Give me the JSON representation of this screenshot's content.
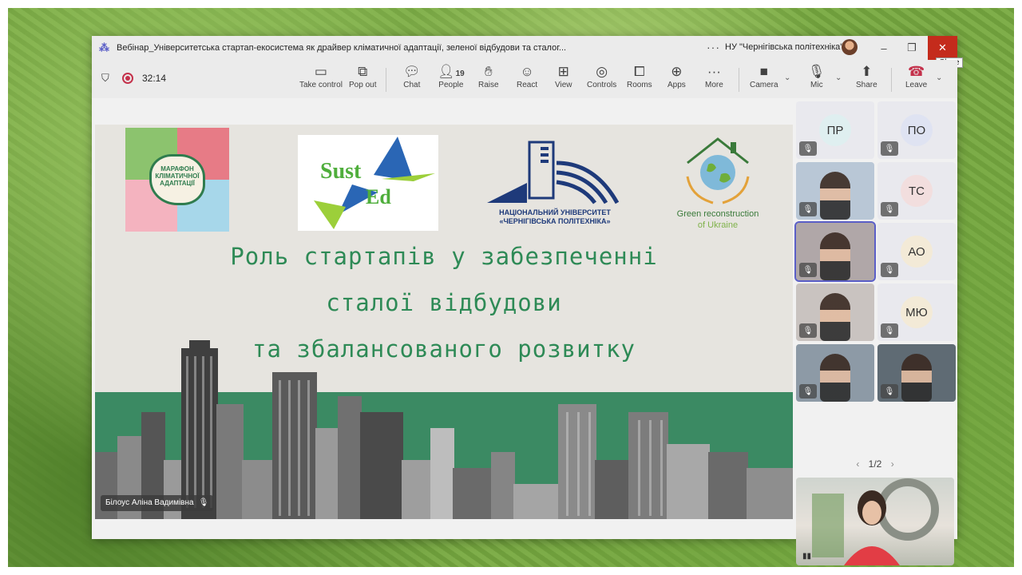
{
  "window": {
    "title": "Вебінар_Університетська стартап-екосистема як драйвер кліматичної адаптації, зеленої відбудови та сталог...",
    "org": "НУ \"Чернігівська політехніка\"",
    "close_tooltip": "Close"
  },
  "meeting": {
    "timer": "32:14",
    "toolbar": {
      "take_control": "Take control",
      "pop_out": "Pop out",
      "chat": "Chat",
      "people": "People",
      "people_count": "19",
      "raise": "Raise",
      "react": "React",
      "view": "View",
      "controls": "Controls",
      "rooms": "Rooms",
      "apps": "Apps",
      "more": "More",
      "camera": "Camera",
      "mic": "Mic",
      "share": "Share",
      "leave": "Leave"
    }
  },
  "slide": {
    "logo1_text": "МАРАФОН КЛІМАТИЧНОЇ АДАПТАЦІЇ",
    "logo2_sust": "Sust",
    "logo2_ed": "Ed",
    "logo3_line1": "НАЦІОНАЛЬНИЙ УНІВЕРСИТЕТ",
    "logo3_line2": "«ЧЕРНІГІВСЬКА ПОЛІТЕХНІКА»",
    "logo4_line1": "Green reconstruction",
    "logo4_line2": "of Ukraine",
    "title_line1": "Роль стартапів у забезпеченні",
    "title_line2": "сталої відбудови",
    "title_line3": "та збалансованого розвитку",
    "presenter_name": "Білоус Аліна Вадимівна"
  },
  "participants": {
    "tiles": [
      {
        "initials": "ПР",
        "color": "#dfeff0"
      },
      {
        "initials": "ПО",
        "color": "#dfe3f2"
      },
      {
        "initials": "",
        "color": ""
      },
      {
        "initials": "ТС",
        "color": "#f2dede"
      },
      {
        "initials": "",
        "color": ""
      },
      {
        "initials": "АО",
        "color": "#f3ead7"
      },
      {
        "initials": "",
        "color": ""
      },
      {
        "initials": "МЮ",
        "color": "#f3ead7"
      },
      {
        "initials": "",
        "color": ""
      },
      {
        "initials": "",
        "color": ""
      }
    ],
    "page": "1/2"
  },
  "colors": {
    "accent": "#5b5fc7",
    "leave": "#c4314b",
    "slide_title": "#2e8a56",
    "band": "#3b8a63"
  }
}
